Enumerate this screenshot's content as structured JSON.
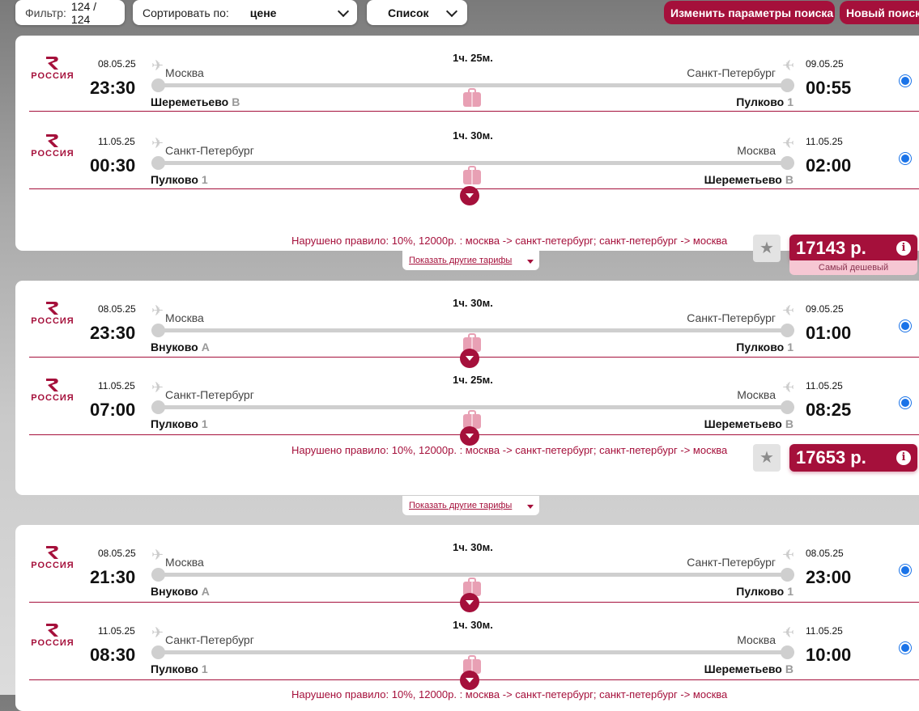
{
  "toolbar": {
    "filter_label": "Фильтр:",
    "filter_value": "124 / 124",
    "sort_label": "Сортировать по:",
    "sort_value": "цене",
    "view_value": "Список",
    "change_search": "Изменить параметры поиска",
    "new_search": "Новый поиск"
  },
  "airline": {
    "name": "РОССИЯ",
    "brand_color": "#a5103b"
  },
  "common": {
    "show_tariffs": "Показать другие тарифы",
    "star": "★",
    "info": "i"
  },
  "offers": [
    {
      "segments": [
        {
          "dep_date": "08.05.25",
          "dep_time": "23:30",
          "dep_city": "Москва",
          "dep_airport": "Шереметьево",
          "dep_term": "B",
          "duration": "1ч. 25м.",
          "arr_date": "09.05.25",
          "arr_time": "00:55",
          "arr_city": "Санкт-Петербург",
          "arr_airport": "Пулково",
          "arr_term": "1"
        },
        {
          "dep_date": "11.05.25",
          "dep_time": "00:30",
          "dep_city": "Санкт-Петербург",
          "dep_airport": "Пулково",
          "dep_term": "1",
          "duration": "1ч. 30м.",
          "arr_date": "11.05.25",
          "arr_time": "02:00",
          "arr_city": "Москва",
          "arr_airport": "Шереметьево",
          "arr_term": "B"
        }
      ],
      "rule": "Нарушено правило: 10%, 12000р. : москва -> санкт-петербург; санкт-петербург -> москва",
      "price": "17143 р.",
      "badge": "Самый дешевый"
    },
    {
      "segments": [
        {
          "dep_date": "08.05.25",
          "dep_time": "23:30",
          "dep_city": "Москва",
          "dep_airport": "Внуково",
          "dep_term": "A",
          "duration": "1ч. 30м.",
          "arr_date": "09.05.25",
          "arr_time": "01:00",
          "arr_city": "Санкт-Петербург",
          "arr_airport": "Пулково",
          "arr_term": "1"
        },
        {
          "dep_date": "11.05.25",
          "dep_time": "07:00",
          "dep_city": "Санкт-Петербург",
          "dep_airport": "Пулково",
          "dep_term": "1",
          "duration": "1ч. 25м.",
          "arr_date": "11.05.25",
          "arr_time": "08:25",
          "arr_city": "Москва",
          "arr_airport": "Шереметьево",
          "arr_term": "B"
        }
      ],
      "rule": "Нарушено правило: 10%, 12000р. : москва -> санкт-петербург; санкт-петербург -> москва",
      "price": "17653 р."
    },
    {
      "segments": [
        {
          "dep_date": "08.05.25",
          "dep_time": "21:30",
          "dep_city": "Москва",
          "dep_airport": "Внуково",
          "dep_term": "A",
          "duration": "1ч. 30м.",
          "arr_date": "08.05.25",
          "arr_time": "23:00",
          "arr_city": "Санкт-Петербург",
          "arr_airport": "Пулково",
          "arr_term": "1"
        },
        {
          "dep_date": "11.05.25",
          "dep_time": "08:30",
          "dep_city": "Санкт-Петербург",
          "dep_airport": "Пулково",
          "dep_term": "1",
          "duration": "1ч. 30м.",
          "arr_date": "11.05.25",
          "arr_time": "10:00",
          "arr_city": "Москва",
          "arr_airport": "Шереметьево",
          "arr_term": "B"
        }
      ],
      "rule": "Нарушено правило: 10%, 12000р. : москва -> санкт-петербург; санкт-петербург -> москва"
    }
  ]
}
